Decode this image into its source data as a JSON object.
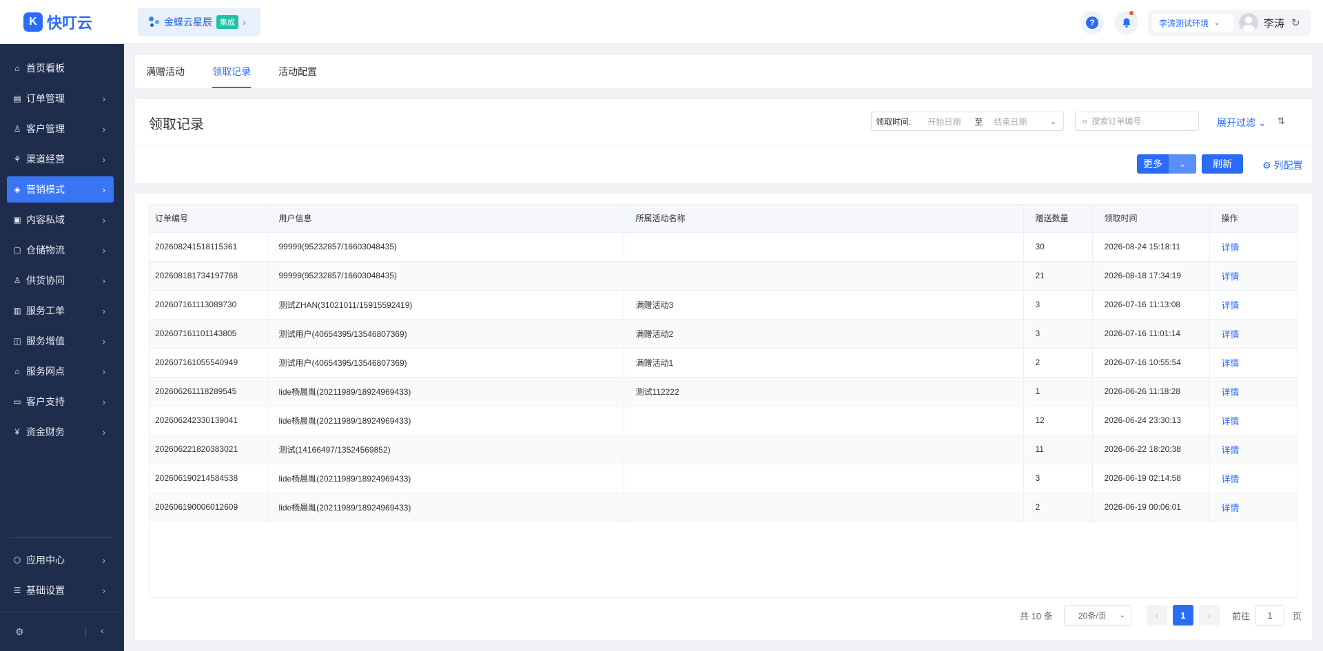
{
  "brand": {
    "name": "快叮云",
    "mark": "K"
  },
  "app_switch": {
    "name": "金蝶云星辰",
    "badge": "集成"
  },
  "header": {
    "env": "李涛测试环境",
    "user": "李涛"
  },
  "sidebar": {
    "items": [
      {
        "label": "首页看板",
        "icon": "home-icon"
      },
      {
        "label": "订单管理",
        "icon": "clipboard-icon"
      },
      {
        "label": "客户管理",
        "icon": "user-icon"
      },
      {
        "label": "渠道经营",
        "icon": "channel-icon"
      },
      {
        "label": "营销模式",
        "icon": "tag-icon",
        "active": true
      },
      {
        "label": "内容私域",
        "icon": "image-icon"
      },
      {
        "label": "仓储物流",
        "icon": "warehouse-icon"
      },
      {
        "label": "供货协同",
        "icon": "supplier-icon"
      },
      {
        "label": "服务工单",
        "icon": "ticket-icon"
      },
      {
        "label": "服务增值",
        "icon": "briefcase-icon"
      },
      {
        "label": "服务网点",
        "icon": "store-icon"
      },
      {
        "label": "客户支持",
        "icon": "support-icon"
      },
      {
        "label": "资金财务",
        "icon": "yen-icon"
      }
    ],
    "bottom_items": [
      {
        "label": "应用中心",
        "icon": "cube-icon"
      },
      {
        "label": "基础设置",
        "icon": "sliders-icon"
      }
    ]
  },
  "tabs": [
    "满赠活动",
    "领取记录",
    "活动配置"
  ],
  "active_tab": 1,
  "page": {
    "title": "领取记录",
    "date_label": "领取时间:",
    "date_start_placeholder": "开始日期",
    "date_sep": "至",
    "date_end_placeholder": "结束日期",
    "search_placeholder": "搜索订单编号",
    "expand_filter": "展开过滤",
    "more_btn": "更多",
    "refresh_btn": "刷新",
    "col_config": "列配置"
  },
  "table": {
    "columns": [
      "订单编号",
      "用户信息",
      "所属活动名称",
      "赠送数量",
      "领取时间",
      "操作"
    ],
    "rows": [
      [
        "202608241518115361",
        "99999(95232857/16603048435)",
        "",
        "30",
        "2026-08-24 15:18:11",
        "详情"
      ],
      [
        "202608181734197768",
        "99999(95232857/16603048435)",
        "",
        "21",
        "2026-08-18 17:34:19",
        "详情"
      ],
      [
        "202607161113089730",
        "测试ZHAN(31021011/15915592419)",
        "满赠活动3",
        "3",
        "2026-07-16 11:13:08",
        "详情"
      ],
      [
        "202607161101143805",
        "测试用户(40654395/13546807369)",
        "满赠活动2",
        "3",
        "2026-07-16 11:01:14",
        "详情"
      ],
      [
        "202607161055540949",
        "测试用户(40654395/13546807369)",
        "满赠活动1",
        "2",
        "2026-07-16 10:55:54",
        "详情"
      ],
      [
        "202606261118289545",
        "lide杨晨胤(20211989/18924969433)",
        "测试112222",
        "1",
        "2026-06-26 11:18:28",
        "详情"
      ],
      [
        "202606242330139041",
        "lide杨晨胤(20211989/18924969433)",
        "",
        "12",
        "2026-06-24 23:30:13",
        "详情"
      ],
      [
        "202606221820383021",
        "测试(14166497/13524569852)",
        "",
        "11",
        "2026-06-22 18:20:38",
        "详情"
      ],
      [
        "202606190214584538",
        "lide杨晨胤(20211989/18924969433)",
        "",
        "3",
        "2026-06-19 02:14:58",
        "详情"
      ],
      [
        "202606190006012609",
        "lide杨晨胤(20211989/18924969433)",
        "",
        "2",
        "2026-06-19 00:06:01",
        "详情"
      ]
    ]
  },
  "pagination": {
    "total": "共 10 条",
    "page_size": "20条/页",
    "current": "1",
    "goto_label": "前往",
    "goto_value": "1",
    "goto_suffix": "页"
  }
}
